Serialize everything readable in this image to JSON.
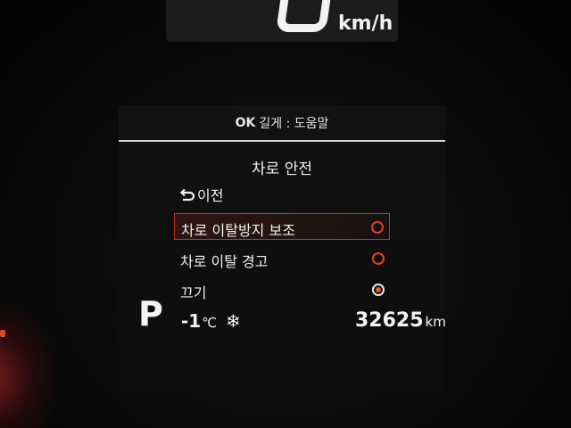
{
  "speed": {
    "unit": "km/h"
  },
  "header": {
    "ok_key": "OK",
    "hint": "길게 : 도움말"
  },
  "menu": {
    "title": "차로 안전",
    "back_label": "이전",
    "options": [
      {
        "label": "차로 이탈방지 보조",
        "selected": false,
        "highlighted": true
      },
      {
        "label": "차로 이탈 경고",
        "selected": false,
        "highlighted": false
      },
      {
        "label": "끄기",
        "selected": true,
        "highlighted": false
      }
    ]
  },
  "status": {
    "gear": "P",
    "temperature": "-1",
    "temperature_unit": "℃",
    "weather_icon": "snowflake-icon",
    "odometer": "32625",
    "odometer_unit": "km"
  },
  "colors": {
    "accent_red": "#d8452e",
    "text": "#f0f0f0",
    "background": "#0c0c0c"
  }
}
